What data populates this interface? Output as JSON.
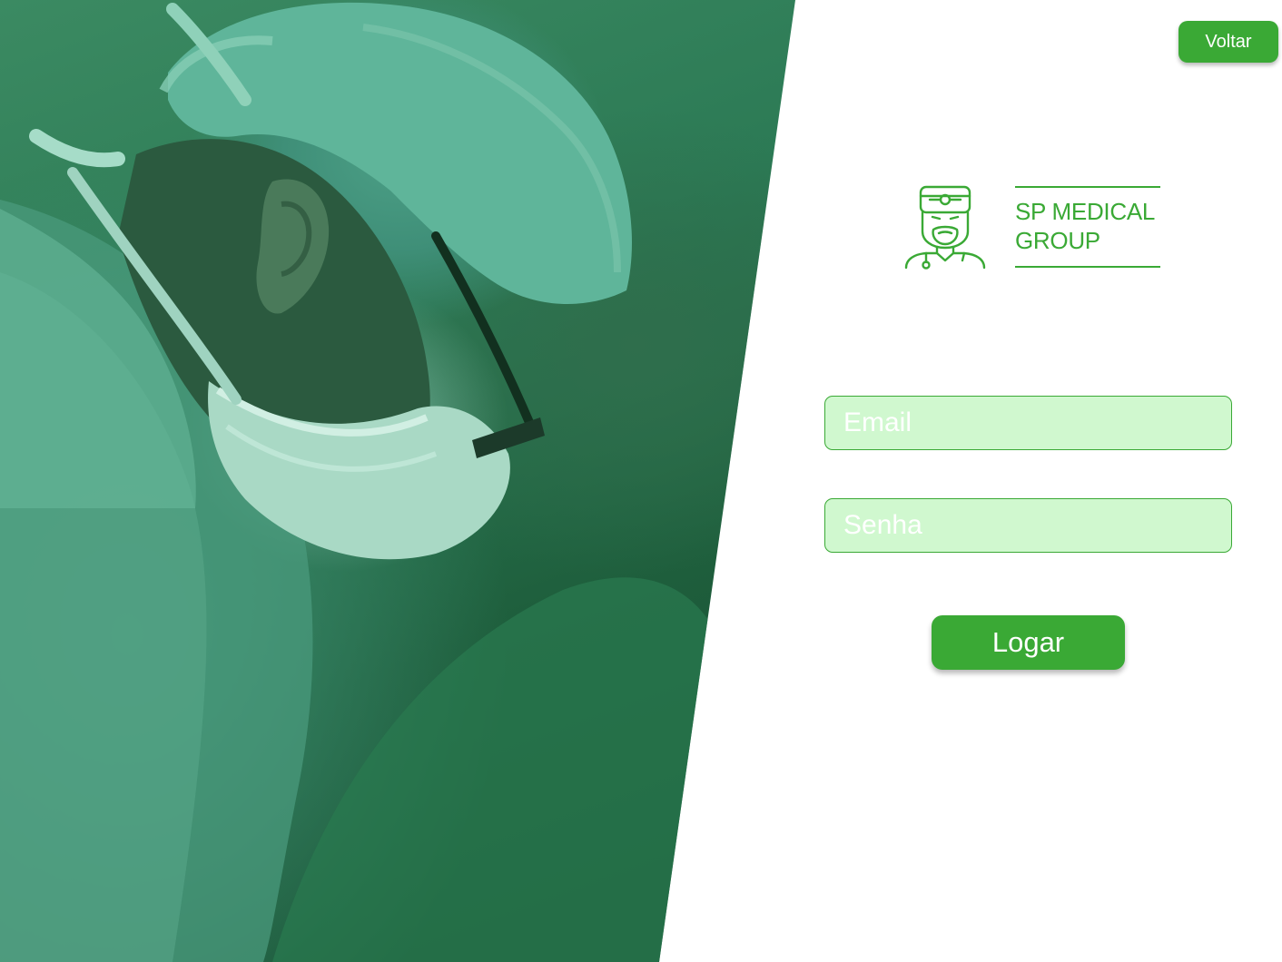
{
  "header": {
    "back_label": "Voltar"
  },
  "brand": {
    "name_line1": "SP MEDICAL",
    "name_line2": "GROUP",
    "icon": "doctor-head-mirror-icon",
    "color": "#3aa935"
  },
  "hero": {
    "image": "surgeon-with-cap-and-mask-photo",
    "overlay_color": "#2c7a55"
  },
  "form": {
    "email_placeholder": "Email",
    "email_value": "",
    "password_placeholder": "Senha",
    "password_value": "",
    "submit_label": "Logar",
    "field_background": "#d0f8cf",
    "button_color": "#3aa935"
  }
}
